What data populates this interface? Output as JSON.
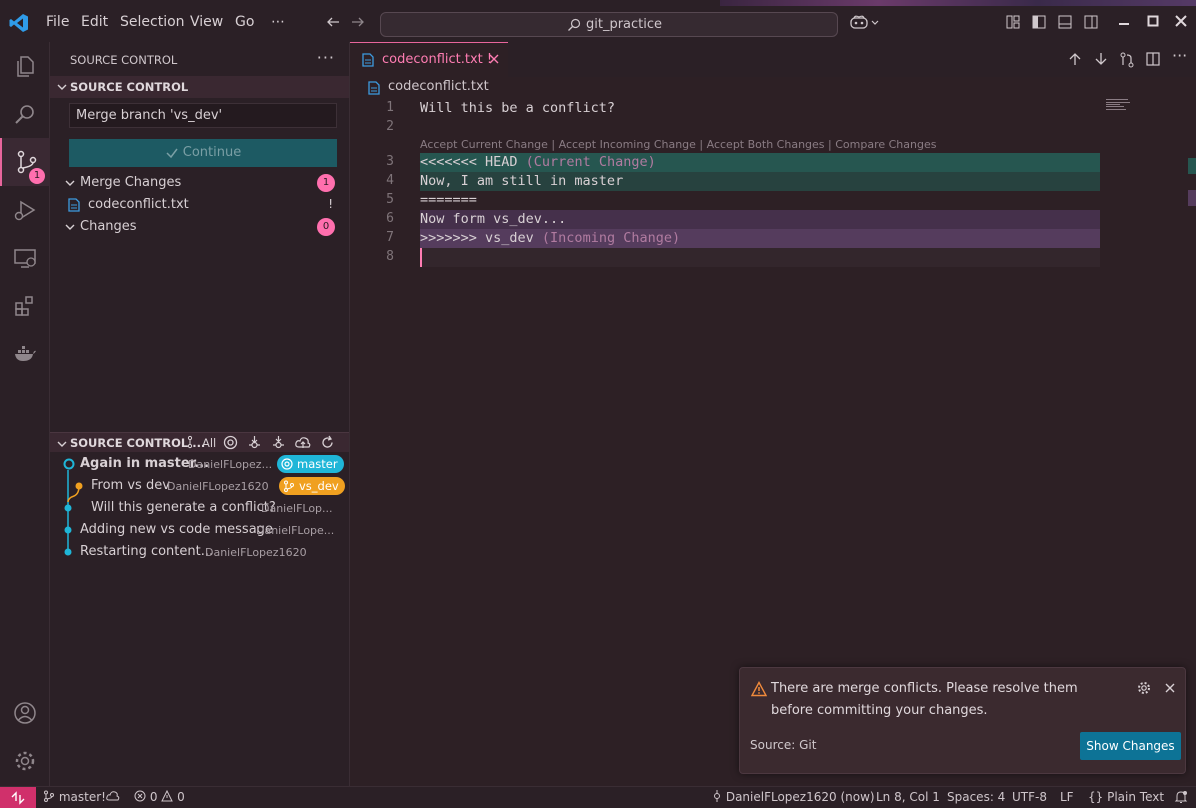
{
  "menu": [
    "File",
    "Edit",
    "Selection",
    "View",
    "Go",
    "⋯"
  ],
  "command_center": {
    "label": "git_practice"
  },
  "sidebar": {
    "view_title": "SOURCE CONTROL",
    "section_title": "SOURCE CONTROL",
    "commit_message": "Merge branch 'vs_dev'",
    "continue_label": "Continue",
    "merge_changes": {
      "label": "Merge Changes",
      "count": "1"
    },
    "merge_file": {
      "name": "codeconflict.txt",
      "status": "!"
    },
    "changes": {
      "label": "Changes",
      "count": "0"
    },
    "activity_badge": "1"
  },
  "graph": {
    "title": "SOURCE CONTROL ...",
    "filter": "All",
    "commits": [
      {
        "message": "Again in master...",
        "author": "DanielFLopez...",
        "ref": "master"
      },
      {
        "message": "From vs dev",
        "author": "DanielFLopez1620",
        "ref": "vs_dev"
      },
      {
        "message": "Will this generate a conflict?",
        "author": "DanielFLop...",
        "ref": ""
      },
      {
        "message": "Adding new vs code message",
        "author": "DanielFLope...",
        "ref": ""
      },
      {
        "message": "Restarting content...",
        "author": "DanielFLopez1620",
        "ref": ""
      }
    ]
  },
  "editor": {
    "tab": {
      "label": "codeconflict.txt",
      "status": "!"
    },
    "breadcrumb": "codeconflict.txt",
    "codelens": "Accept Current Change | Accept Incoming Change | Accept Both Changes | Compare Changes",
    "lines": [
      {
        "num": "1",
        "text": "Will this be a conflict?",
        "suffix": ""
      },
      {
        "num": "2",
        "text": "",
        "suffix": ""
      },
      {
        "num": "3",
        "text": "<<<<<<< HEAD",
        "suffix": " (Current Change)"
      },
      {
        "num": "4",
        "text": "Now, I am still in master",
        "suffix": ""
      },
      {
        "num": "5",
        "text": "=======",
        "suffix": ""
      },
      {
        "num": "6",
        "text": "Now form vs_dev...",
        "suffix": ""
      },
      {
        "num": "7",
        "text": ">>>>>>> vs_dev",
        "suffix": " (Incoming Change)"
      },
      {
        "num": "8",
        "text": "",
        "suffix": ""
      }
    ]
  },
  "notification": {
    "message": "There are merge conflicts. Please resolve them before committing your changes.",
    "source": "Source: Git",
    "action": "Show Changes"
  },
  "status": {
    "branch": "master!",
    "errors": "0",
    "warnings": "0",
    "author": "DanielFLopez1620 (now)",
    "position": "Ln 8, Col 1",
    "spaces": "Spaces: 4",
    "encoding": "UTF-8",
    "eol": "LF",
    "language": "Plain Text"
  },
  "colors": {
    "accent": "#e8659c",
    "badge": "#ff6fae",
    "current_change": "#265650",
    "incoming_change": "#553c5d",
    "master_ref": "#1fb6d8",
    "vs_dev_ref": "#f0a020",
    "button": "#0d7396"
  }
}
